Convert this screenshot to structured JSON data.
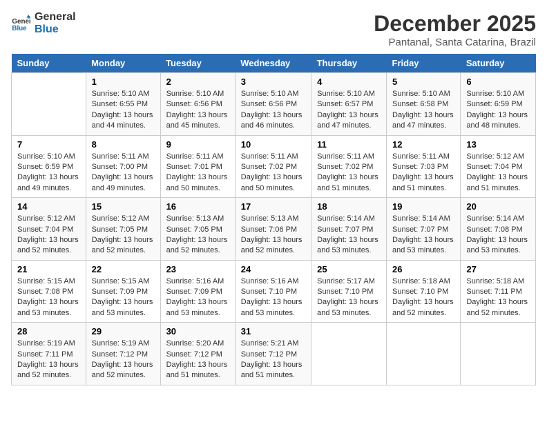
{
  "logo": {
    "text_general": "General",
    "text_blue": "Blue"
  },
  "header": {
    "title": "December 2025",
    "subtitle": "Pantanal, Santa Catarina, Brazil"
  },
  "weekdays": [
    "Sunday",
    "Monday",
    "Tuesday",
    "Wednesday",
    "Thursday",
    "Friday",
    "Saturday"
  ],
  "weeks": [
    [
      {
        "day": "",
        "info": ""
      },
      {
        "day": "1",
        "info": "Sunrise: 5:10 AM\nSunset: 6:55 PM\nDaylight: 13 hours\nand 44 minutes."
      },
      {
        "day": "2",
        "info": "Sunrise: 5:10 AM\nSunset: 6:56 PM\nDaylight: 13 hours\nand 45 minutes."
      },
      {
        "day": "3",
        "info": "Sunrise: 5:10 AM\nSunset: 6:56 PM\nDaylight: 13 hours\nand 46 minutes."
      },
      {
        "day": "4",
        "info": "Sunrise: 5:10 AM\nSunset: 6:57 PM\nDaylight: 13 hours\nand 47 minutes."
      },
      {
        "day": "5",
        "info": "Sunrise: 5:10 AM\nSunset: 6:58 PM\nDaylight: 13 hours\nand 47 minutes."
      },
      {
        "day": "6",
        "info": "Sunrise: 5:10 AM\nSunset: 6:59 PM\nDaylight: 13 hours\nand 48 minutes."
      }
    ],
    [
      {
        "day": "7",
        "info": "Sunrise: 5:10 AM\nSunset: 6:59 PM\nDaylight: 13 hours\nand 49 minutes."
      },
      {
        "day": "8",
        "info": "Sunrise: 5:11 AM\nSunset: 7:00 PM\nDaylight: 13 hours\nand 49 minutes."
      },
      {
        "day": "9",
        "info": "Sunrise: 5:11 AM\nSunset: 7:01 PM\nDaylight: 13 hours\nand 50 minutes."
      },
      {
        "day": "10",
        "info": "Sunrise: 5:11 AM\nSunset: 7:02 PM\nDaylight: 13 hours\nand 50 minutes."
      },
      {
        "day": "11",
        "info": "Sunrise: 5:11 AM\nSunset: 7:02 PM\nDaylight: 13 hours\nand 51 minutes."
      },
      {
        "day": "12",
        "info": "Sunrise: 5:11 AM\nSunset: 7:03 PM\nDaylight: 13 hours\nand 51 minutes."
      },
      {
        "day": "13",
        "info": "Sunrise: 5:12 AM\nSunset: 7:04 PM\nDaylight: 13 hours\nand 51 minutes."
      }
    ],
    [
      {
        "day": "14",
        "info": "Sunrise: 5:12 AM\nSunset: 7:04 PM\nDaylight: 13 hours\nand 52 minutes."
      },
      {
        "day": "15",
        "info": "Sunrise: 5:12 AM\nSunset: 7:05 PM\nDaylight: 13 hours\nand 52 minutes."
      },
      {
        "day": "16",
        "info": "Sunrise: 5:13 AM\nSunset: 7:05 PM\nDaylight: 13 hours\nand 52 minutes."
      },
      {
        "day": "17",
        "info": "Sunrise: 5:13 AM\nSunset: 7:06 PM\nDaylight: 13 hours\nand 52 minutes."
      },
      {
        "day": "18",
        "info": "Sunrise: 5:14 AM\nSunset: 7:07 PM\nDaylight: 13 hours\nand 53 minutes."
      },
      {
        "day": "19",
        "info": "Sunrise: 5:14 AM\nSunset: 7:07 PM\nDaylight: 13 hours\nand 53 minutes."
      },
      {
        "day": "20",
        "info": "Sunrise: 5:14 AM\nSunset: 7:08 PM\nDaylight: 13 hours\nand 53 minutes."
      }
    ],
    [
      {
        "day": "21",
        "info": "Sunrise: 5:15 AM\nSunset: 7:08 PM\nDaylight: 13 hours\nand 53 minutes."
      },
      {
        "day": "22",
        "info": "Sunrise: 5:15 AM\nSunset: 7:09 PM\nDaylight: 13 hours\nand 53 minutes."
      },
      {
        "day": "23",
        "info": "Sunrise: 5:16 AM\nSunset: 7:09 PM\nDaylight: 13 hours\nand 53 minutes."
      },
      {
        "day": "24",
        "info": "Sunrise: 5:16 AM\nSunset: 7:10 PM\nDaylight: 13 hours\nand 53 minutes."
      },
      {
        "day": "25",
        "info": "Sunrise: 5:17 AM\nSunset: 7:10 PM\nDaylight: 13 hours\nand 53 minutes."
      },
      {
        "day": "26",
        "info": "Sunrise: 5:18 AM\nSunset: 7:10 PM\nDaylight: 13 hours\nand 52 minutes."
      },
      {
        "day": "27",
        "info": "Sunrise: 5:18 AM\nSunset: 7:11 PM\nDaylight: 13 hours\nand 52 minutes."
      }
    ],
    [
      {
        "day": "28",
        "info": "Sunrise: 5:19 AM\nSunset: 7:11 PM\nDaylight: 13 hours\nand 52 minutes."
      },
      {
        "day": "29",
        "info": "Sunrise: 5:19 AM\nSunset: 7:12 PM\nDaylight: 13 hours\nand 52 minutes."
      },
      {
        "day": "30",
        "info": "Sunrise: 5:20 AM\nSunset: 7:12 PM\nDaylight: 13 hours\nand 51 minutes."
      },
      {
        "day": "31",
        "info": "Sunrise: 5:21 AM\nSunset: 7:12 PM\nDaylight: 13 hours\nand 51 minutes."
      },
      {
        "day": "",
        "info": ""
      },
      {
        "day": "",
        "info": ""
      },
      {
        "day": "",
        "info": ""
      }
    ]
  ]
}
